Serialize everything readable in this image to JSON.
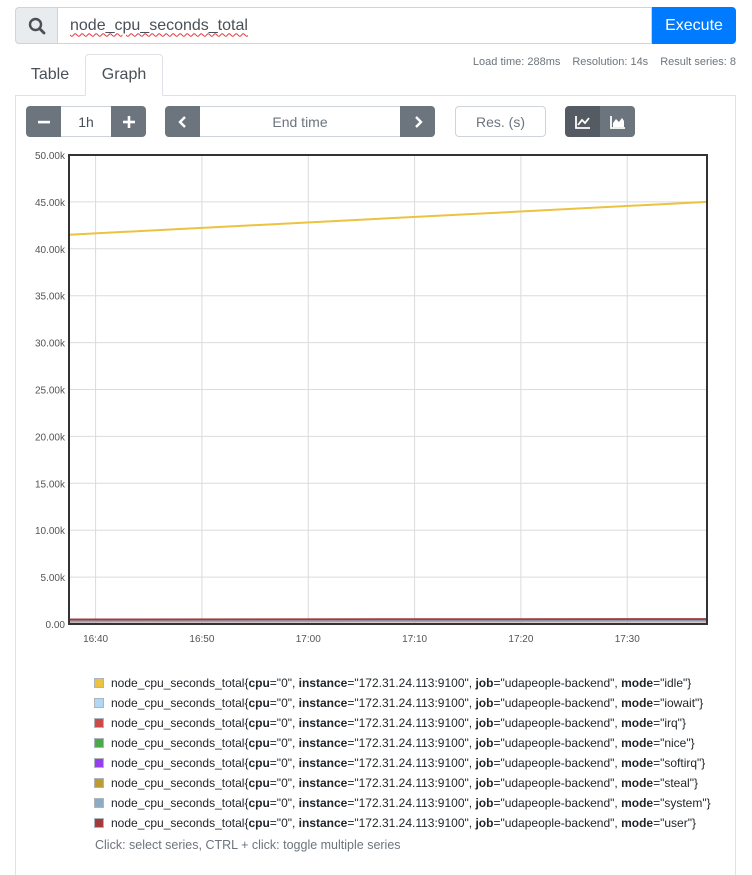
{
  "query": {
    "search_icon": "search-icon",
    "expression": "node_cpu_seconds_total",
    "execute_label": "Execute"
  },
  "tabs": [
    {
      "label": "Table",
      "active": false
    },
    {
      "label": "Graph",
      "active": true
    }
  ],
  "stats": {
    "load_time": "Load time: 288ms",
    "resolution": "Resolution: 14s",
    "result_series": "Result series: 8"
  },
  "controls": {
    "range_minus": "−",
    "range_value": "1h",
    "range_plus": "+",
    "end_prev": "‹",
    "end_time_placeholder": "End time",
    "end_next": "›",
    "resolution_placeholder": "Res. (s)",
    "chart_type_line_icon": "line-chart-icon",
    "chart_type_stacked_icon": "area-chart-icon",
    "chart_type_selected": "line"
  },
  "chart_data": {
    "type": "line",
    "x_ticks": [
      "16:40",
      "16:50",
      "17:00",
      "17:10",
      "17:20",
      "17:30"
    ],
    "x_tick_minutes": [
      0,
      10,
      20,
      30,
      40,
      50
    ],
    "x_range_minutes": [
      -2.5,
      57.5
    ],
    "y_ticks": [
      "0.00",
      "5.00k",
      "10.00k",
      "15.00k",
      "20.00k",
      "25.00k",
      "30.00k",
      "35.00k",
      "40.00k",
      "45.00k",
      "50.00k"
    ],
    "ylim": [
      0,
      50000
    ],
    "grid": true,
    "series": [
      {
        "name": "idle",
        "color": "#edc240",
        "values": [
          [
            -2.5,
            41500
          ],
          [
            57.5,
            45000
          ]
        ]
      },
      {
        "name": "iowait",
        "color": "#afd8f8",
        "values": [
          [
            -2.5,
            30
          ],
          [
            57.5,
            35
          ]
        ]
      },
      {
        "name": "irq",
        "color": "#cb4b4b",
        "values": [
          [
            -2.5,
            0
          ],
          [
            57.5,
            0
          ]
        ]
      },
      {
        "name": "nice",
        "color": "#4da74d",
        "values": [
          [
            -2.5,
            5
          ],
          [
            57.5,
            6
          ]
        ]
      },
      {
        "name": "softirq",
        "color": "#9440ed",
        "values": [
          [
            -2.5,
            25
          ],
          [
            57.5,
            30
          ]
        ]
      },
      {
        "name": "steal",
        "color": "#bd9b33",
        "values": [
          [
            -2.5,
            20
          ],
          [
            57.5,
            22
          ]
        ]
      },
      {
        "name": "system",
        "color": "#8cacc6",
        "values": [
          [
            -2.5,
            300
          ],
          [
            57.5,
            330
          ]
        ]
      },
      {
        "name": "user",
        "color": "#a23c3c",
        "values": [
          [
            -2.5,
            480
          ],
          [
            57.5,
            520
          ]
        ]
      }
    ]
  },
  "legend": {
    "metric": "node_cpu_seconds_total",
    "items": [
      {
        "cpu": "\"0\"",
        "instance": "\"172.31.24.113:9100\"",
        "job": "\"udapeople-backend\"",
        "mode": "\"idle\"",
        "color": "#edc240"
      },
      {
        "cpu": "\"0\"",
        "instance": "\"172.31.24.113:9100\"",
        "job": "\"udapeople-backend\"",
        "mode": "\"iowait\"",
        "color": "#afd8f8"
      },
      {
        "cpu": "\"0\"",
        "instance": "\"172.31.24.113:9100\"",
        "job": "\"udapeople-backend\"",
        "mode": "\"irq\"",
        "color": "#cb4b4b"
      },
      {
        "cpu": "\"0\"",
        "instance": "\"172.31.24.113:9100\"",
        "job": "\"udapeople-backend\"",
        "mode": "\"nice\"",
        "color": "#4da74d"
      },
      {
        "cpu": "\"0\"",
        "instance": "\"172.31.24.113:9100\"",
        "job": "\"udapeople-backend\"",
        "mode": "\"softirq\"",
        "color": "#9440ed"
      },
      {
        "cpu": "\"0\"",
        "instance": "\"172.31.24.113:9100\"",
        "job": "\"udapeople-backend\"",
        "mode": "\"steal\"",
        "color": "#bd9b33"
      },
      {
        "cpu": "\"0\"",
        "instance": "\"172.31.24.113:9100\"",
        "job": "\"udapeople-backend\"",
        "mode": "\"system\"",
        "color": "#8cacc6"
      },
      {
        "cpu": "\"0\"",
        "instance": "\"172.31.24.113:9100\"",
        "job": "\"udapeople-backend\"",
        "mode": "\"user\"",
        "color": "#a23c3c"
      }
    ],
    "hint": "Click: select series, CTRL + click: toggle multiple series"
  }
}
